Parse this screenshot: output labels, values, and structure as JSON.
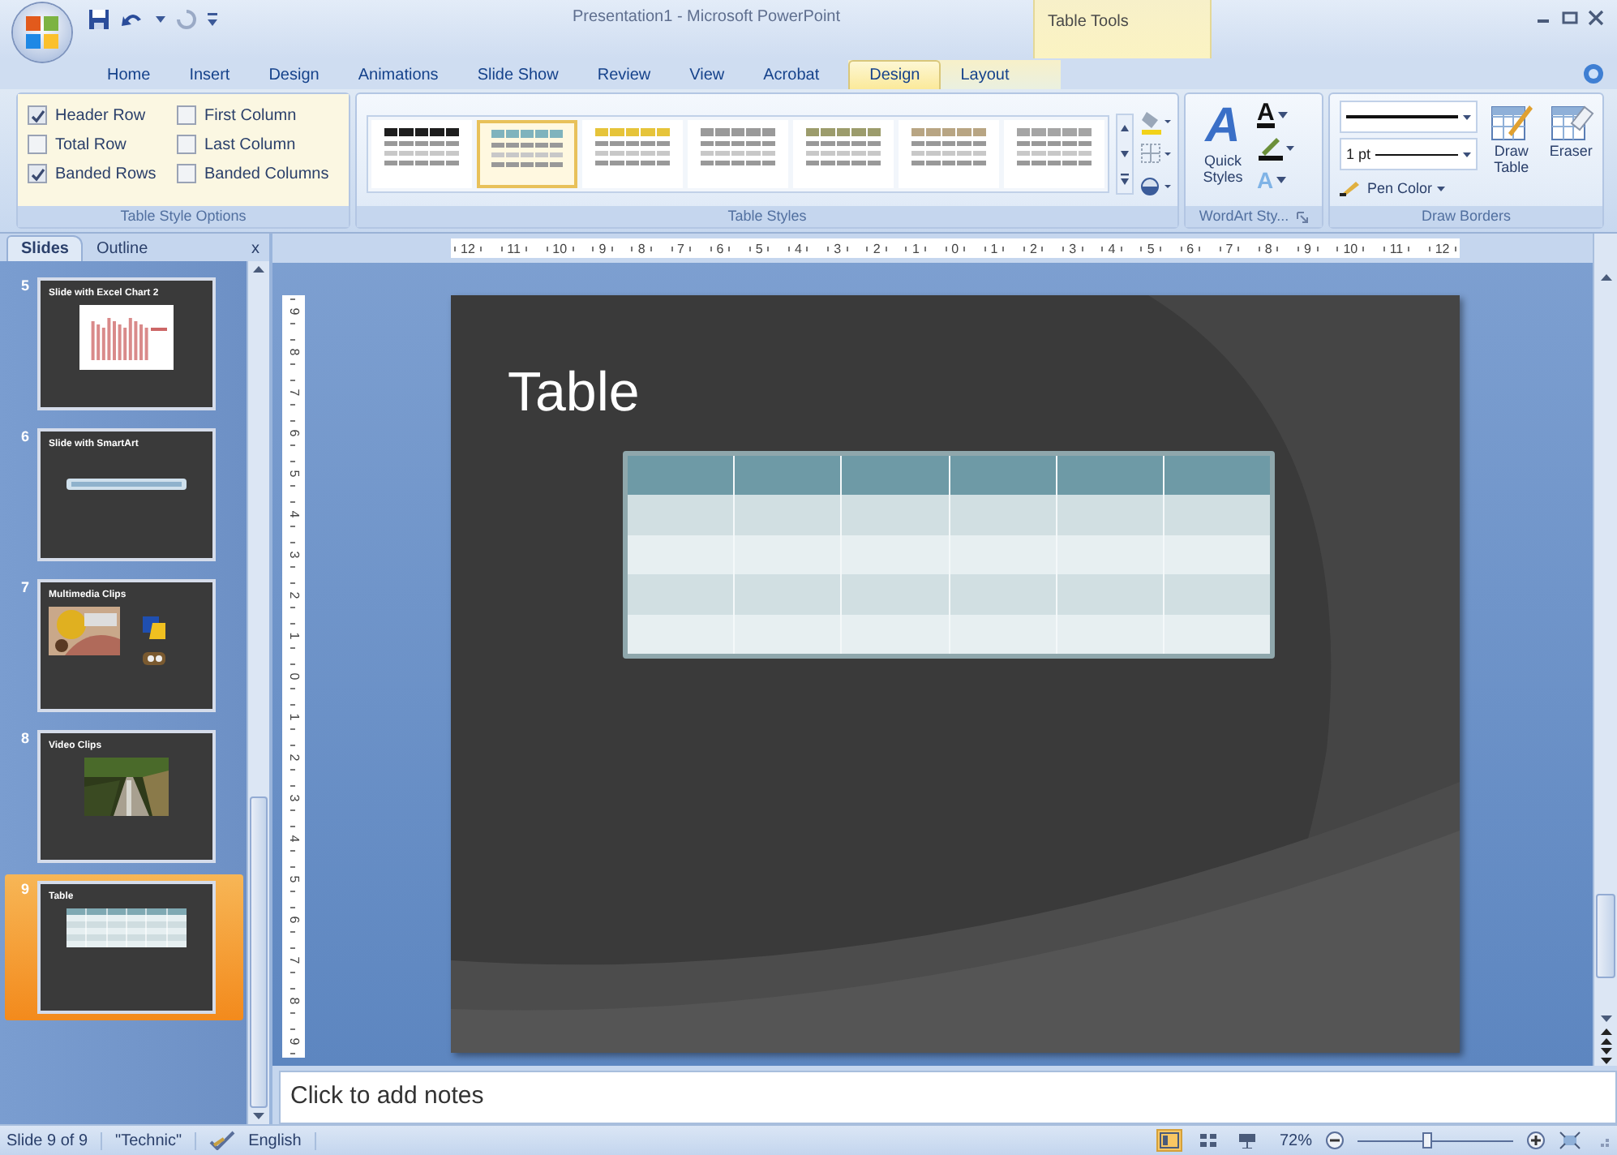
{
  "window": {
    "title": "Presentation1 - Microsoft PowerPoint"
  },
  "ribbon_tabs": [
    {
      "label": "Home",
      "selected": false
    },
    {
      "label": "Insert",
      "selected": false
    },
    {
      "label": "Design",
      "selected": false
    },
    {
      "label": "Animations",
      "selected": false
    },
    {
      "label": "Slide Show",
      "selected": false
    },
    {
      "label": "Review",
      "selected": false
    },
    {
      "label": "View",
      "selected": false
    },
    {
      "label": "Acrobat",
      "selected": false
    }
  ],
  "contextual": {
    "label": "Table Tools",
    "tabs": [
      {
        "label": "Design",
        "selected": true
      },
      {
        "label": "Layout",
        "selected": false
      }
    ]
  },
  "table_style_options": {
    "label": "Table Style Options",
    "options": [
      {
        "label": "Header Row",
        "checked": true
      },
      {
        "label": "First Column",
        "checked": false
      },
      {
        "label": "Total Row",
        "checked": false
      },
      {
        "label": "Last Column",
        "checked": false
      },
      {
        "label": "Banded Rows",
        "checked": true
      },
      {
        "label": "Banded Columns",
        "checked": false
      }
    ]
  },
  "table_styles": {
    "label": "Table Styles",
    "styles": [
      {
        "color": "#1e1e1e",
        "selected": false
      },
      {
        "color": "#7fb3bd",
        "selected": true
      },
      {
        "color": "#e6c43a",
        "selected": false
      },
      {
        "color": "#9a9a9a",
        "selected": false
      },
      {
        "color": "#9c9c6c",
        "selected": false
      },
      {
        "color": "#b8a583",
        "selected": false
      },
      {
        "color": "#a5a5a5",
        "selected": false
      }
    ]
  },
  "wordart": {
    "label": "WordArt Sty...",
    "quick_styles": "Quick Styles",
    "quick_glyph": "A",
    "fill_glyph": "A",
    "effects_glyph": "A"
  },
  "draw_borders": {
    "label": "Draw Borders",
    "pen_weight": "1 pt",
    "pen_color": "Pen Color",
    "draw_table": "Draw Table",
    "eraser": "Eraser"
  },
  "slides_pane": {
    "tabs": [
      {
        "label": "Slides",
        "selected": true
      },
      {
        "label": "Outline",
        "selected": false
      }
    ],
    "close": "x",
    "slides": [
      {
        "number": "5",
        "title": "Slide with Excel Chart 2",
        "kind": "chart",
        "selected": false
      },
      {
        "number": "6",
        "title": "Slide with SmartArt",
        "kind": "smartart",
        "selected": false
      },
      {
        "number": "7",
        "title": "Multimedia Clips",
        "kind": "media",
        "selected": false
      },
      {
        "number": "8",
        "title": "Video Clips",
        "kind": "video",
        "selected": false
      },
      {
        "number": "9",
        "title": "Table",
        "kind": "table",
        "selected": true
      }
    ]
  },
  "ruler": {
    "horizontal": [
      "12",
      "11",
      "10",
      "9",
      "8",
      "7",
      "6",
      "5",
      "4",
      "3",
      "2",
      "1",
      "0",
      "1",
      "2",
      "3",
      "4",
      "5",
      "6",
      "7",
      "8",
      "9",
      "10",
      "11",
      "12"
    ],
    "vertical": [
      "9",
      "8",
      "7",
      "6",
      "5",
      "4",
      "3",
      "2",
      "1",
      "0",
      "1",
      "2",
      "3",
      "4",
      "5",
      "6",
      "7",
      "8",
      "9"
    ]
  },
  "slide": {
    "title": "Table"
  },
  "notes": {
    "placeholder": "Click to add notes"
  },
  "status_bar": {
    "slide": "Slide 9 of 9",
    "theme": "\"Technic\"",
    "language": "English",
    "views": [
      {
        "kind": "normal",
        "selected": true
      },
      {
        "kind": "sorter",
        "selected": false
      },
      {
        "kind": "show",
        "selected": false
      }
    ],
    "zoom": "72%",
    "zoom_slider": {
      "level": 0.45
    }
  }
}
